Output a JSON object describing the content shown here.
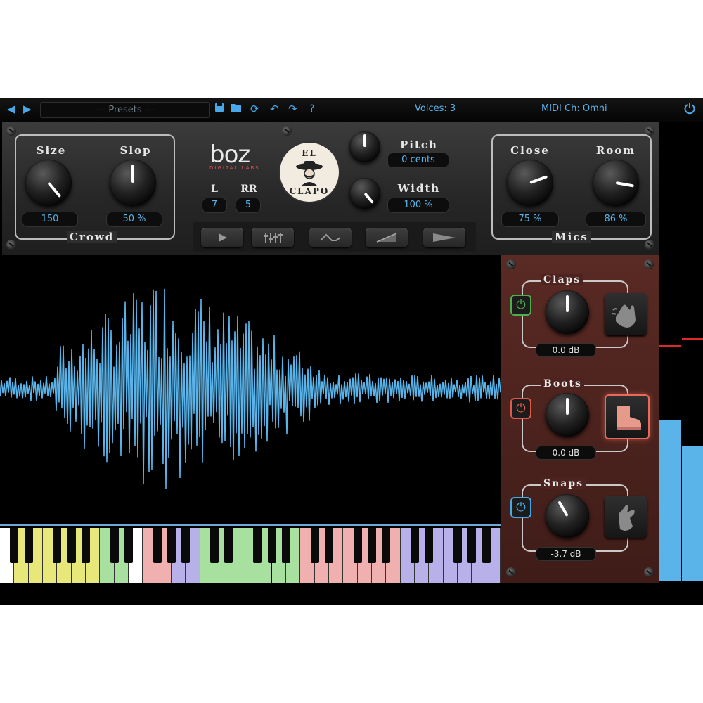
{
  "topbar": {
    "prev_icon": "triangle-left-icon",
    "next_icon": "triangle-right-icon",
    "preset_label": "--- Presets ---",
    "voices": "Voices: 3",
    "midi_channel": "MIDI Ch: Omni",
    "tools": [
      "save-icon",
      "folder-icon",
      "reload-icon",
      "undo-icon",
      "redo-icon",
      "help-icon"
    ]
  },
  "crowd": {
    "title": "Crowd",
    "size_label": "Size",
    "size_value": "150",
    "slop_label": "Slop",
    "slop_value": "50 %"
  },
  "brand": {
    "logo": "boz",
    "logo_sub": "DIGITAL LABS",
    "badge_top": "EL",
    "badge_bottom": "CLAPO",
    "l_label": "L",
    "l_value": "7",
    "rr_label": "RR",
    "rr_value": "5"
  },
  "pitch": {
    "label": "Pitch",
    "value": "0 cents"
  },
  "width": {
    "label": "Width",
    "value": "100 %"
  },
  "mics": {
    "title": "Mics",
    "close_label": "Close",
    "close_value": "75 %",
    "room_label": "Room",
    "room_value": "86 %"
  },
  "tabs": [
    "play-icon",
    "mixer-icon",
    "envelope-icon",
    "ramp-icon",
    "wedge-icon"
  ],
  "sections": {
    "claps": {
      "title": "Claps",
      "value": "0.0 dB",
      "power_color": "#4caf50",
      "icon": "clap-hands-icon"
    },
    "boots": {
      "title": "Boots",
      "value": "0.0 dB",
      "power_color": "#e05a4a",
      "icon": "boot-icon",
      "active": true
    },
    "snaps": {
      "title": "Snaps",
      "value": "-3.7 dB",
      "power_color": "#4aa8e8",
      "icon": "snap-hand-icon"
    }
  },
  "colors": {
    "accent": "#5ab4ea",
    "waveform": "#5ab4ea",
    "panel_red": "#4c231f"
  },
  "meters": {
    "left_level": 0.67,
    "right_level": 0.57
  }
}
